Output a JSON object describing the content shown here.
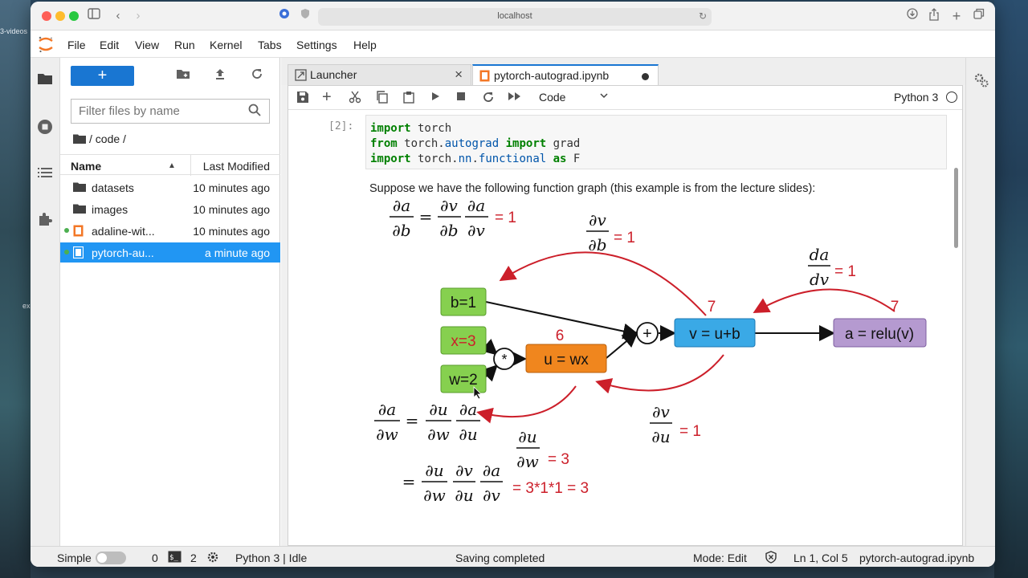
{
  "desktop": {
    "left_label_top": "3-videos",
    "left_label_bottom": "ex"
  },
  "browser": {
    "url": "localhost"
  },
  "menu": {
    "items": [
      "File",
      "Edit",
      "View",
      "Run",
      "Kernel",
      "Tabs",
      "Settings",
      "Help"
    ]
  },
  "filebrowser": {
    "new_button": "+",
    "filter_placeholder": "Filter files by name",
    "breadcrumb": "/ code /",
    "col_name": "Name",
    "col_modified": "Last Modified",
    "files": [
      {
        "name": "datasets",
        "modified": "10 minutes ago",
        "type": "folder",
        "running": false,
        "selected": false
      },
      {
        "name": "images",
        "modified": "10 minutes ago",
        "type": "folder",
        "running": false,
        "selected": false
      },
      {
        "name": "adaline-wit...",
        "modified": "10 minutes ago",
        "type": "notebook",
        "running": true,
        "selected": false
      },
      {
        "name": "pytorch-au...",
        "modified": "a minute ago",
        "type": "notebook",
        "running": true,
        "selected": true
      }
    ]
  },
  "tabs": [
    {
      "label": "Launcher",
      "active": false
    },
    {
      "label": "pytorch-autograd.ipynb",
      "active": true
    }
  ],
  "toolbar": {
    "cell_type": "Code",
    "kernel": "Python 3"
  },
  "cells": {
    "prompt": "[2]:",
    "code": [
      {
        "parts": [
          [
            "kw",
            "import"
          ],
          [
            "txt",
            " torch"
          ]
        ]
      },
      {
        "parts": [
          [
            "kw",
            "from"
          ],
          [
            "txt",
            " torch."
          ],
          [
            "mod",
            "autograd"
          ],
          [
            "txt",
            " "
          ],
          [
            "kw",
            "import"
          ],
          [
            "txt",
            " grad"
          ]
        ]
      },
      {
        "parts": [
          [
            "kw",
            "import"
          ],
          [
            "txt",
            " torch."
          ],
          [
            "mod",
            "nn"
          ],
          [
            "txt",
            "."
          ],
          [
            "mod",
            "functional"
          ],
          [
            "txt",
            " "
          ],
          [
            "kw",
            "as"
          ],
          [
            "txt",
            " F"
          ]
        ]
      }
    ],
    "markdown": "Suppose we have the following function graph (this example is from the lecture slides):"
  },
  "diagram": {
    "nodes": {
      "b": "b=1",
      "x": "x=3",
      "w": "w=2",
      "mul": "*",
      "u": "u = wx",
      "plus": "+",
      "v": "v = u+b",
      "a": "a = relu(v)"
    },
    "node_values": {
      "u": "6",
      "v": "7",
      "a": "7"
    },
    "grads": {
      "da_db": {
        "lhs_num": "∂a",
        "lhs_den": "∂b",
        "t1_num": "∂v",
        "t1_den": "∂b",
        "t2_num": "∂a",
        "t2_den": "∂v",
        "eq": "= 1"
      },
      "dv_db": {
        "num": "∂v",
        "den": "∂b",
        "eq": "= 1"
      },
      "da_dv": {
        "num": "da",
        "den": "dv",
        "eq": "= 1"
      },
      "dv_du": {
        "num": "∂v",
        "den": "∂u",
        "eq": "= 1"
      },
      "du_dw": {
        "num": "∂u",
        "den": "∂w",
        "eq": "= 3"
      },
      "da_dw": {
        "lhs_num": "∂a",
        "lhs_den": "∂w",
        "t1_num": "∂u",
        "t1_den": "∂w",
        "t2_num": "∂a",
        "t2_den": "∂u",
        "r1_num": "∂u",
        "r1_den": "∂w",
        "r2_num": "∂v",
        "r2_den": "∂u",
        "r3_num": "∂a",
        "r3_den": "∂v",
        "result": "= 3*1*1 = 3"
      }
    },
    "colors": {
      "green": "#86d04f",
      "orange": "#f0861e",
      "blue": "#3aa9e6",
      "purple": "#b59ad0",
      "red": "#cc1f2a"
    }
  },
  "statusbar": {
    "mode_label": "Simple",
    "terminals": "0",
    "kernels": "2",
    "kernel_status": "Python 3 | Idle",
    "saving": "Saving completed",
    "mode": "Mode: Edit",
    "position": "Ln 1, Col 5",
    "filename": "pytorch-autograd.ipynb"
  }
}
